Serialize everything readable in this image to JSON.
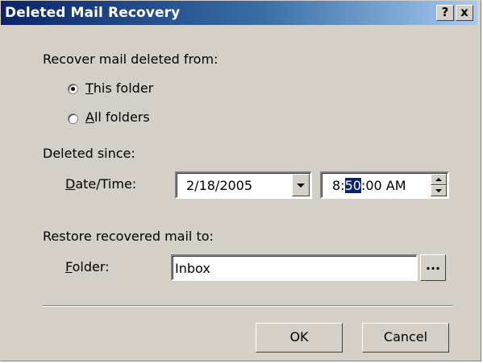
{
  "window": {
    "title": "Deleted Mail Recovery",
    "help_label": "?",
    "close_label": "x"
  },
  "recover_from": {
    "label": "Recover mail deleted from:",
    "options": [
      {
        "label": "This folder",
        "checked": true
      },
      {
        "label": "All folders",
        "checked": false
      }
    ]
  },
  "deleted_since": {
    "label": "Deleted since:",
    "datetime_label": "Date/Time:",
    "date_value": "2/18/2005",
    "time_before": "8:",
    "time_selected": "50",
    "time_after": ":00 AM"
  },
  "restore": {
    "label": "Restore recovered mail to:",
    "folder_label": "Folder:",
    "folder_value": "Inbox",
    "browse_label": "..."
  },
  "buttons": {
    "ok": "OK",
    "cancel": "Cancel"
  }
}
